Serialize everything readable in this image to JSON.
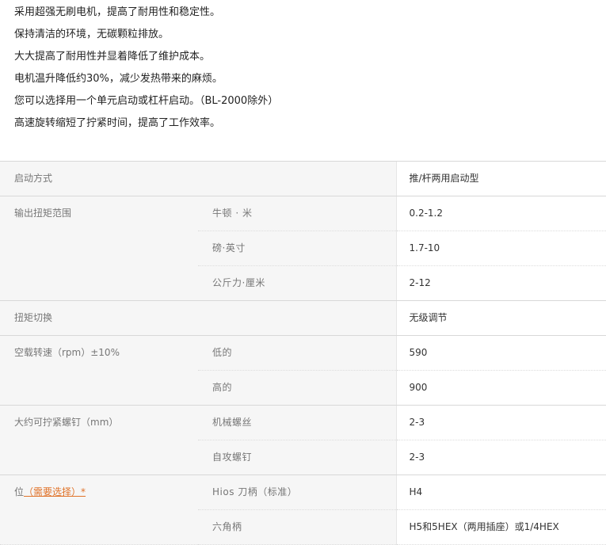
{
  "features": [
    "采用超强无刷电机，提高了耐用性和稳定性。",
    "保持清洁的环境，无碳颗粒排放。",
    "大大提高了耐用性并显着降低了维护成本。",
    "电机温升降低约30%，减少发热带来的麻烦。",
    "您可以选择用一个单元启动或杠杆启动。（BL-2000除外）",
    "高速旋转缩短了拧紧时间，提高了工作效率。"
  ],
  "specs": {
    "start_mode": {
      "label": "启动方式",
      "value": "推/杆两用启动型"
    },
    "torque_range": {
      "label": "输出扭矩范围",
      "rows": [
        {
          "unit": "牛顿 · 米",
          "value": "0.2-1.2"
        },
        {
          "unit": "磅·英寸",
          "value": "1.7-10"
        },
        {
          "unit": "公斤力·厘米",
          "value": "2-12"
        }
      ]
    },
    "torque_switch": {
      "label": "扭矩切换",
      "value": "无级调节"
    },
    "no_load_speed": {
      "label": "空载转速（rpm）±10%",
      "rows": [
        {
          "unit": "低的",
          "value": "590"
        },
        {
          "unit": "高的",
          "value": "900"
        }
      ]
    },
    "screw_size": {
      "label": "大约可拧紧螺钉（mm）",
      "rows": [
        {
          "unit": "机械螺丝",
          "value": "2-3"
        },
        {
          "unit": "自攻螺钉",
          "value": "2-3"
        }
      ]
    },
    "bit": {
      "label": "位",
      "required": "（需要选择）*",
      "rows": [
        {
          "unit": "Hios 刀柄（标准）",
          "value": "H4"
        },
        {
          "unit": "六角柄",
          "value": "H5和5HEX（两用插座）或1/4HEX"
        }
      ]
    }
  },
  "colors": {
    "accent": "#e0732a",
    "label_bg": "#f6f6f6"
  }
}
